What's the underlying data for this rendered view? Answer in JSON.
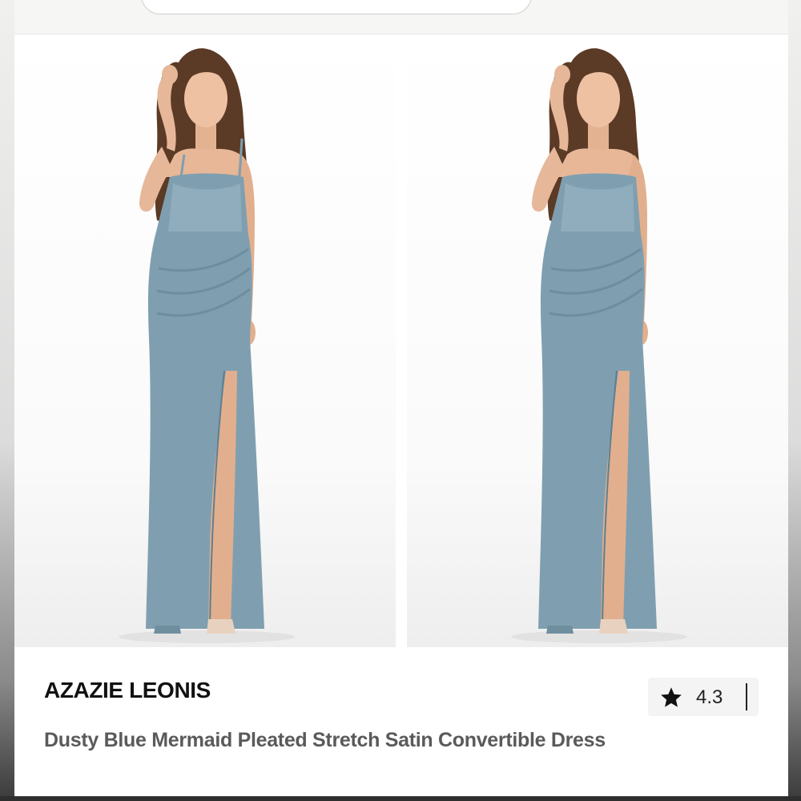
{
  "product": {
    "brand": "AZAZIE LEONIS",
    "title": "Dusty Blue Mermaid Pleated Stretch Satin Convertible Dress",
    "rating": "4.3",
    "dress_color": "#7f9fb0"
  },
  "gallery": {
    "images": [
      {
        "alt": "Model wearing dress with straps"
      },
      {
        "alt": "Model wearing dress strapless"
      }
    ]
  },
  "icons": {
    "rating_icon": "star-icon"
  }
}
